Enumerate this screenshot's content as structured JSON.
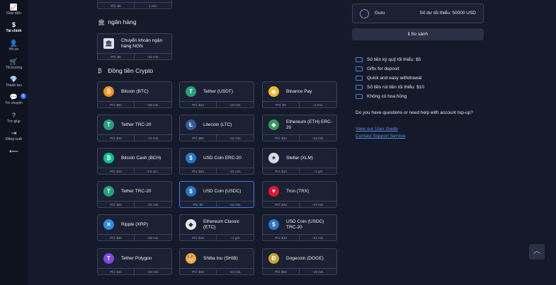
{
  "nav": [
    {
      "icon": "📈",
      "label": "Giao dịch"
    },
    {
      "icon": "$",
      "label": "Tài chính"
    },
    {
      "icon": "👤",
      "label": "Hồ sơ"
    },
    {
      "icon": "🛒",
      "label": "Thị trường"
    },
    {
      "icon": "💎",
      "label": "Thành tựu"
    },
    {
      "icon": "💬",
      "label": "Trò chuyện",
      "badge": "6"
    },
    {
      "icon": "?",
      "label": "Trợ giúp"
    },
    {
      "icon": "⇥",
      "label": "Đăng xuất"
    },
    {
      "icon": "⟵",
      "label": ""
    }
  ],
  "partial_card": {
    "fee": "Phí: $5",
    "time": "1 min."
  },
  "bank_section": {
    "title": "ngân hàng",
    "icon": "🏛"
  },
  "bank_card": {
    "name": "Chuyển khoản ngân hàng NGN",
    "fee": "Phí: $5",
    "time": "~32 min."
  },
  "crypto_section": {
    "title": "Đồng tiền Crypto",
    "icon": "₿"
  },
  "crypto_cards": [
    {
      "name": "Bitcoin (BTC)",
      "fee": "Phí: $50",
      "time": "~28 min.",
      "icon": "₿",
      "color": "#f7931a"
    },
    {
      "name": "Tether (USDT)",
      "fee": "Phí: $10",
      "time": "~10 min.",
      "icon": "T",
      "color": "#26a17b"
    },
    {
      "name": "Binance Pay",
      "fee": "Phí: $5",
      "time": "~1 min.",
      "icon": "◆",
      "color": "#f3ba2f"
    },
    {
      "name": "Tether TRC-20",
      "fee": "Phí: $10",
      "time": "~11 min.",
      "icon": "T",
      "color": "#26a17b"
    },
    {
      "name": "Litecoin (LTC)",
      "fee": "Phí: $50",
      "time": "~12 min.",
      "icon": "Ł",
      "color": "#345d9d"
    },
    {
      "name": "Ethereum (ETH) ERC-20",
      "fee": "Phí: $20",
      "time": "~42 min.",
      "icon": "◆",
      "color": "#2c9e58"
    },
    {
      "name": "Bitcoin Cash (BCH)",
      "fee": "Phí: $10",
      "time": "3-5 min.",
      "icon": "₿",
      "color": "#0ac18e"
    },
    {
      "name": "USD Coin ERC-20",
      "fee": "Phí: $20",
      "time": "~31 min.",
      "icon": "$",
      "color": "#2775ca"
    },
    {
      "name": "Stellar (XLM)",
      "fee": "Phí: $10",
      "time": "~1 giờ",
      "icon": "✦",
      "color": "#d8dbe3"
    },
    {
      "name": "Tether TRC-20",
      "fee": "Phí: $20",
      "time": "~21 min.",
      "icon": "T",
      "color": "#26a17b"
    },
    {
      "name": "USD Coin (USDC)",
      "fee": "Phí: $5",
      "time": "~12 min.",
      "icon": "$",
      "color": "#2775ca",
      "selected": true
    },
    {
      "name": "Tron (TRX)",
      "fee": "Phí: $25",
      "time": "~47 min.",
      "icon": "▼",
      "color": "#e5142c"
    },
    {
      "name": "Ripple (XRP)",
      "fee": "Phí: $30",
      "time": "~58 min.",
      "icon": "✕",
      "color": "#2a8ee0"
    },
    {
      "name": "Ethereum Classic (ETC)",
      "fee": "Phí: $15",
      "time": "~1 giờ",
      "icon": "◆",
      "color": "#e8e8e8"
    },
    {
      "name": "USD Coin (USDC) TRC-20",
      "fee": "Phí: $10",
      "time": "~21 min.",
      "icon": "$",
      "color": "#2775ca"
    },
    {
      "name": "Tether Polygon",
      "fee": "Phí: $10",
      "time": "~22 min.",
      "icon": "T",
      "color": "#8247e5"
    },
    {
      "name": "Shiba Inu (SHIB)",
      "fee": "Phí: $40",
      "time": "~23 min.",
      "icon": "🐕",
      "color": "#f2a93b"
    },
    {
      "name": "Dogecoin (DOGE)",
      "fee": "Phí: $50",
      "time": "~19 min.",
      "icon": "Ð",
      "color": "#c2a633"
    }
  ],
  "right": {
    "account": "Guru",
    "min_balance": "Số dư tối thiểu: 50000 USD",
    "compare": "So sánh",
    "features": [
      "Số tiền ký quỹ tối thiểu: $5",
      "Gifts for deposit",
      "Quick and easy withdrawal",
      "Số tiền rút tiền tối thiểu: $10",
      "Không có hoa hồng"
    ],
    "help": "Do you have questions or need help with account top-up?",
    "link1": "View our User Guide",
    "link2": "Contact Support Service"
  }
}
